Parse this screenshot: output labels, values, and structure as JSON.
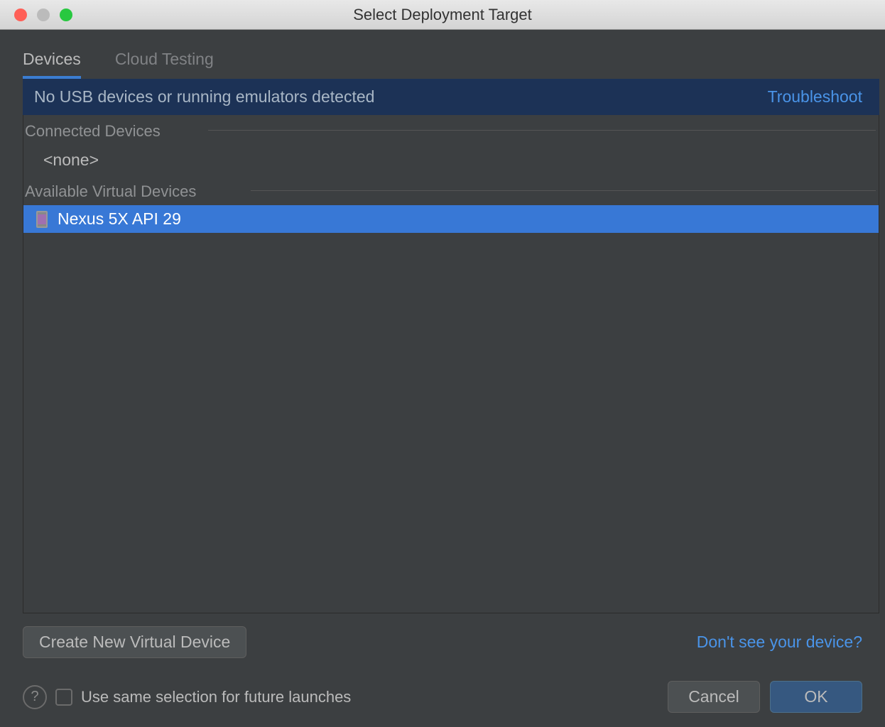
{
  "window": {
    "title": "Select Deployment Target"
  },
  "tabs": {
    "devices": "Devices",
    "cloud_testing": "Cloud Testing"
  },
  "status": {
    "message": "No USB devices or running emulators detected",
    "troubleshoot": "Troubleshoot"
  },
  "sections": {
    "connected": {
      "header": "Connected Devices",
      "none_text": "<none>"
    },
    "available": {
      "header": "Available Virtual Devices",
      "devices": [
        {
          "name": "Nexus 5X API 29"
        }
      ]
    }
  },
  "footer": {
    "create_button": "Create New Virtual Device",
    "device_link": "Don't see your device?",
    "checkbox_label": "Use same selection for future launches",
    "cancel": "Cancel",
    "ok": "OK"
  }
}
